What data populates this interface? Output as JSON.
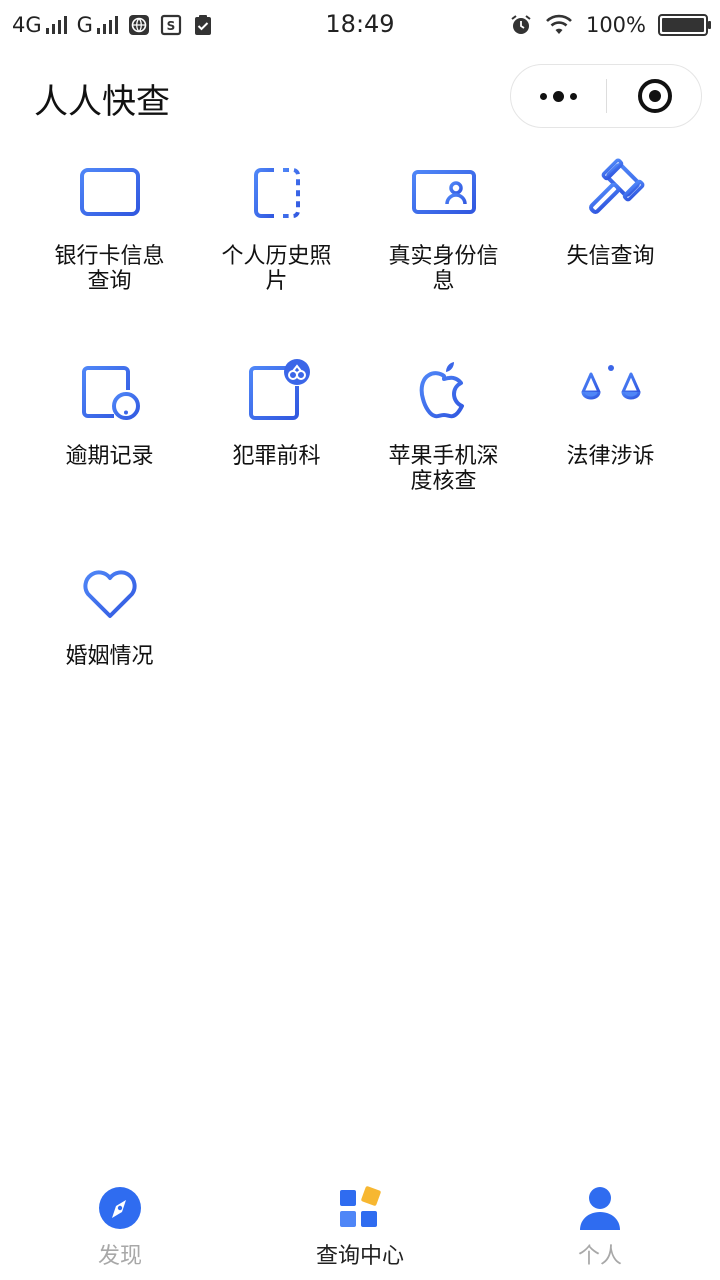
{
  "status_bar": {
    "network_1": "4G",
    "network_2": "G",
    "time": "18:49",
    "battery": "100%",
    "battery_level": 1.0
  },
  "nav": {
    "title": "人人快查"
  },
  "colors": {
    "accent": "#3b66e8",
    "accent_light": "#4f86f7",
    "tab_inactive": "#a8a8a8",
    "tab_active": "#222222",
    "yellow": "#f7b731"
  },
  "services": [
    {
      "label": "银行卡信息查询",
      "icon": "bank-card-icon"
    },
    {
      "label": "个人历史照片",
      "icon": "split-frame-icon"
    },
    {
      "label": "真实身份信息",
      "icon": "id-card-icon"
    },
    {
      "label": "失信查询",
      "icon": "gavel-icon"
    },
    {
      "label": "逾期记录",
      "icon": "overdue-calendar-icon"
    },
    {
      "label": "犯罪前科",
      "icon": "criminal-record-icon"
    },
    {
      "label": "苹果手机深度核查",
      "icon": "apple-icon"
    },
    {
      "label": "法律涉诉",
      "icon": "scales-icon"
    },
    {
      "label": "婚姻情况",
      "icon": "heart-icon"
    }
  ],
  "tabbar": {
    "items": [
      {
        "label": "发现",
        "icon": "compass-icon",
        "active": false
      },
      {
        "label": "查询中心",
        "icon": "grid-blocks-icon",
        "active": true
      },
      {
        "label": "个人",
        "icon": "person-icon",
        "active": false
      }
    ]
  }
}
